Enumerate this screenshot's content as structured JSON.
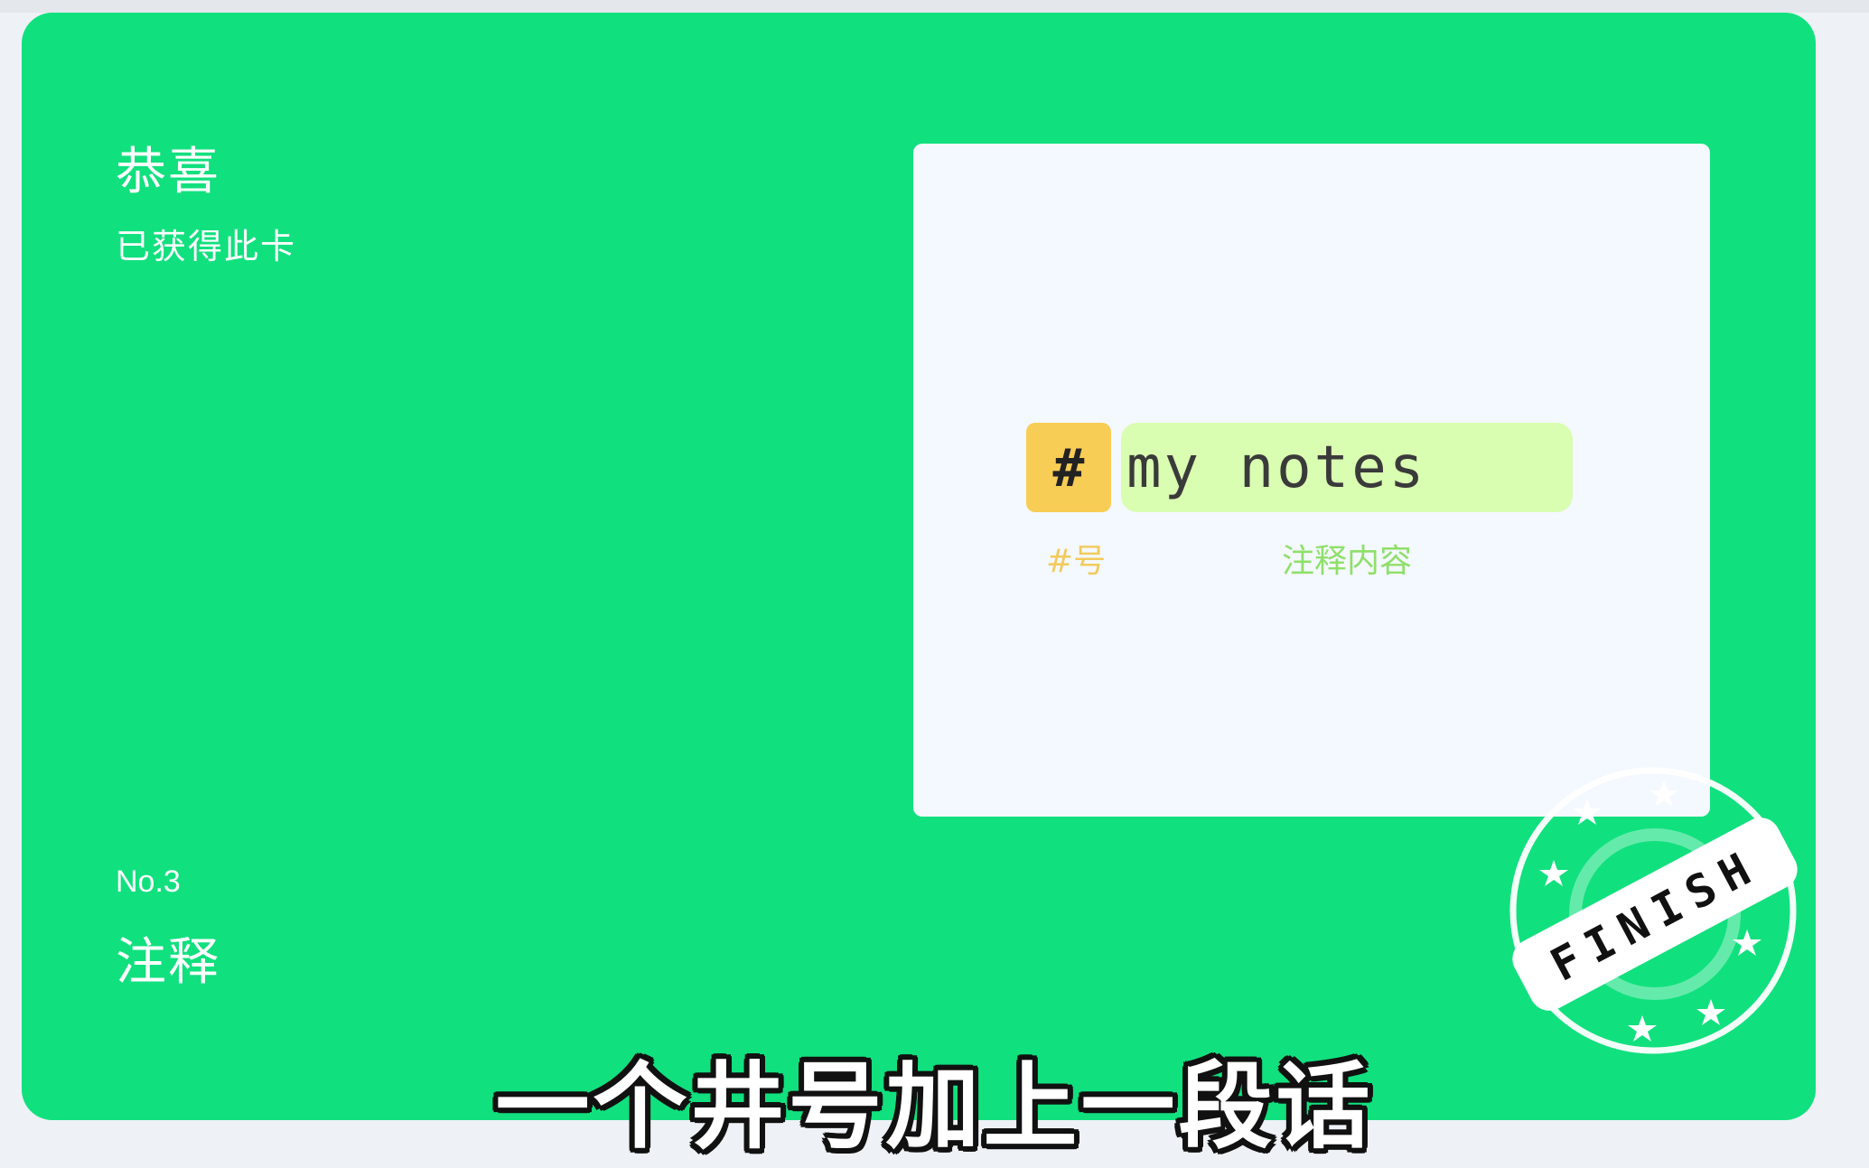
{
  "card": {
    "congrats_title": "恭喜",
    "congrats_subtitle": "已获得此卡",
    "number": "No.3",
    "name": "注释"
  },
  "example": {
    "hash_symbol": "#",
    "note_text": "my notes",
    "hash_caption": "#号",
    "note_caption": "注释内容"
  },
  "stamp": {
    "text": "FINISH",
    "icon": "finish-stamp-icon"
  },
  "subtitle": "一个井号加上一段话",
  "colors": {
    "card_green": "#11e07e",
    "panel_bg": "#f4f8ff",
    "hash_yellow": "#f8cd55",
    "note_green": "#d9fdb1",
    "hash_caption": "#f2cb5c",
    "note_caption": "#8fe06a"
  }
}
